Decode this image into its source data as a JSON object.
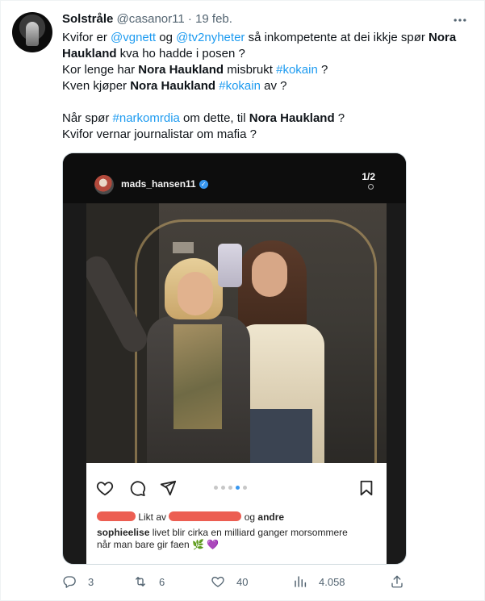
{
  "tweet": {
    "author_name": "Solstråle",
    "author_handle": "@casanor11",
    "separator": "·",
    "date": "19 feb.",
    "more_icon": "more-horizontal-icon",
    "lines": [
      [
        {
          "t": "Kvifor er ",
          "s": "plain"
        },
        {
          "t": "@vgnett",
          "s": "link"
        },
        {
          "t": " og ",
          "s": "plain"
        },
        {
          "t": "@tv2nyheter",
          "s": "link"
        },
        {
          "t": " så inkompetente at dei ikkje spør ",
          "s": "plain"
        },
        {
          "t": "Nora",
          "s": "bold"
        }
      ],
      [
        {
          "t": "Haukland",
          "s": "bold"
        },
        {
          "t": " kva ho hadde i posen ?",
          "s": "plain"
        }
      ],
      [
        {
          "t": "Kor lenge har ",
          "s": "plain"
        },
        {
          "t": "Nora Haukland",
          "s": "bold"
        },
        {
          "t": " misbrukt ",
          "s": "plain"
        },
        {
          "t": "#kokain",
          "s": "link"
        },
        {
          "t": " ?",
          "s": "plain"
        }
      ],
      [
        {
          "t": "Kven kjøper ",
          "s": "plain"
        },
        {
          "t": "Nora Haukland",
          "s": "bold"
        },
        {
          "t": " ",
          "s": "plain"
        },
        {
          "t": "#kokain",
          "s": "link"
        },
        {
          "t": " av ?",
          "s": "plain"
        }
      ],
      [],
      [
        {
          "t": "Når spør ",
          "s": "plain"
        },
        {
          "t": "#narkomrdia",
          "s": "link"
        },
        {
          "t": " om dette, til ",
          "s": "plain"
        },
        {
          "t": "Nora Haukland",
          "s": "bold"
        },
        {
          "t": " ?",
          "s": "plain"
        }
      ],
      [
        {
          "t": "Kvifor vernar journalistar om mafia ?",
          "s": "plain"
        }
      ]
    ]
  },
  "media": {
    "ig_username": "mads_hansen11",
    "ig_verified_icon": "verified-badge-icon",
    "page_indicator": "1/2",
    "liked_prefix": "Likt av",
    "liked_middle": "og",
    "liked_suffix": "andre",
    "caption_user": "sophieelise",
    "caption_text": "livet blir cirka en milliard ganger morsommere når man bare gir faen",
    "caption_emoji": "🌿 💜",
    "carousel_dots": 5,
    "carousel_active": 4
  },
  "actions": {
    "reply_count": "3",
    "retweet_count": "6",
    "like_count": "40",
    "views_count": "4.058"
  },
  "colors": {
    "link": "#1d9bf0",
    "muted": "#536471",
    "redaction": "#ec5e52"
  }
}
